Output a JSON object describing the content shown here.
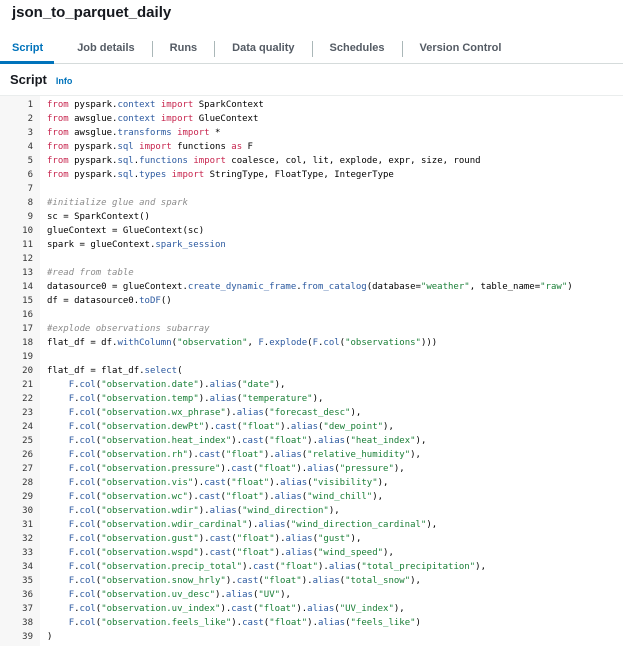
{
  "job": {
    "title": "json_to_parquet_daily"
  },
  "tabs": [
    {
      "label": "Script",
      "active": true
    },
    {
      "label": "Job details",
      "active": false
    },
    {
      "label": "Runs",
      "active": false
    },
    {
      "label": "Data quality",
      "active": false
    },
    {
      "label": "Schedules",
      "active": false
    },
    {
      "label": "Version Control",
      "active": false
    }
  ],
  "section": {
    "title": "Script",
    "info_label": "Info"
  },
  "colors": {
    "accent": "#0073bb",
    "keyword": "#c7254e",
    "string": "#1a7f37",
    "comment": "#8c8c8c",
    "attribute": "#2c5aa0"
  },
  "code_lines": [
    "from pyspark.context import SparkContext",
    "from awsglue.context import GlueContext",
    "from awsglue.transforms import *",
    "from pyspark.sql import functions as F",
    "from pyspark.sql.functions import coalesce, col, lit, explode, expr, size, round",
    "from pyspark.sql.types import StringType, FloatType, IntegerType",
    "",
    "#initialize glue and spark",
    "sc = SparkContext()",
    "glueContext = GlueContext(sc)",
    "spark = glueContext.spark_session",
    "",
    "#read from table",
    "datasource0 = glueContext.create_dynamic_frame.from_catalog(database=\"weather\", table_name=\"raw\")",
    "df = datasource0.toDF()",
    "",
    "#explode observations subarray",
    "flat_df = df.withColumn(\"observation\", F.explode(F.col(\"observations\")))",
    "",
    "flat_df = flat_df.select(",
    "    F.col(\"observation.date\").alias(\"date\"),",
    "    F.col(\"observation.temp\").alias(\"temperature\"),",
    "    F.col(\"observation.wx_phrase\").alias(\"forecast_desc\"),",
    "    F.col(\"observation.dewPt\").cast(\"float\").alias(\"dew_point\"),",
    "    F.col(\"observation.heat_index\").cast(\"float\").alias(\"heat_index\"),",
    "    F.col(\"observation.rh\").cast(\"float\").alias(\"relative_humidity\"),",
    "    F.col(\"observation.pressure\").cast(\"float\").alias(\"pressure\"),",
    "    F.col(\"observation.vis\").cast(\"float\").alias(\"visibility\"),",
    "    F.col(\"observation.wc\").cast(\"float\").alias(\"wind_chill\"),",
    "    F.col(\"observation.wdir\").alias(\"wind_direction\"),",
    "    F.col(\"observation.wdir_cardinal\").alias(\"wind_direction_cardinal\"),",
    "    F.col(\"observation.gust\").cast(\"float\").alias(\"gust\"),",
    "    F.col(\"observation.wspd\").cast(\"float\").alias(\"wind_speed\"),",
    "    F.col(\"observation.precip_total\").cast(\"float\").alias(\"total_precipitation\"),",
    "    F.col(\"observation.snow_hrly\").cast(\"float\").alias(\"total_snow\"),",
    "    F.col(\"observation.uv_desc\").alias(\"UV\"),",
    "    F.col(\"observation.uv_index\").cast(\"float\").alias(\"UV_index\"),",
    "    F.col(\"observation.feels_like\").cast(\"float\").alias(\"feels_like\")",
    ")"
  ]
}
